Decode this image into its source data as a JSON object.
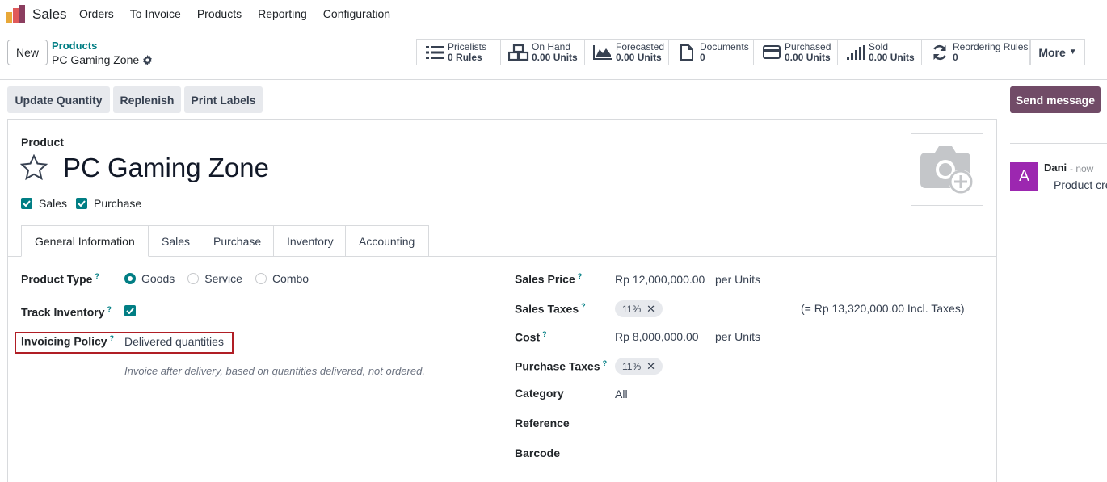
{
  "nav": {
    "app_name": "Sales",
    "menu": [
      "Orders",
      "To Invoice",
      "Products",
      "Reporting",
      "Configuration"
    ]
  },
  "control_panel": {
    "new_label": "New",
    "breadcrumb_parent": "Products",
    "breadcrumb_current": "PC Gaming Zone",
    "smart_buttons": [
      {
        "label": "Pricelists",
        "value": "0",
        "unit": "Rules",
        "icon": "list-icon"
      },
      {
        "label": "On Hand",
        "value": "0.00",
        "unit": "Units",
        "icon": "cubes-icon"
      },
      {
        "label": "Forecasted",
        "value": "0.00",
        "unit": "Units",
        "icon": "area-chart-icon"
      },
      {
        "label": "Documents",
        "value": "0",
        "unit": "",
        "icon": "document-icon"
      },
      {
        "label": "Purchased",
        "value": "0.00",
        "unit": "Units",
        "icon": "credit-card-icon"
      },
      {
        "label": "Sold",
        "value": "0.00",
        "unit": "Units",
        "icon": "signal-icon"
      },
      {
        "label": "Reordering Rules",
        "value": "0",
        "unit": "",
        "icon": "refresh-icon"
      }
    ],
    "more_label": "More"
  },
  "actions": {
    "update_quantity": "Update Quantity",
    "replenish": "Replenish",
    "print_labels": "Print Labels",
    "send_message": "Send message"
  },
  "product": {
    "section_label": "Product",
    "name": "PC Gaming Zone",
    "checks": {
      "sales": "Sales",
      "purchase": "Purchase"
    }
  },
  "tabs": [
    "General Information",
    "Sales",
    "Purchase",
    "Inventory",
    "Accounting"
  ],
  "general": {
    "product_type_label": "Product Type",
    "product_type_options": [
      "Goods",
      "Service",
      "Combo"
    ],
    "product_type_selected": "Goods",
    "track_inventory_label": "Track Inventory",
    "track_inventory": true,
    "invoicing_policy_label": "Invoicing Policy",
    "invoicing_policy_value": "Delivered quantities",
    "invoicing_hint": "Invoice after delivery, based on quantities delivered, not ordered.",
    "sales_price_label": "Sales Price",
    "sales_price": "Rp 12,000,000.00",
    "per_units_1": "per Units",
    "sales_taxes_label": "Sales Taxes",
    "sales_tax": "11%",
    "incl_taxes": "(= Rp 13,320,000.00 Incl. Taxes)",
    "cost_label": "Cost",
    "cost": "Rp 8,000,000.00",
    "per_units_2": "per Units",
    "purchase_taxes_label": "Purchase Taxes",
    "purchase_tax": "11%",
    "category_label": "Category",
    "category": "All",
    "reference_label": "Reference",
    "barcode_label": "Barcode",
    "help_mark": "?"
  },
  "chatter": {
    "avatar_letter": "A",
    "author": "Dani",
    "time": "- now",
    "message": "Product created"
  },
  "colors": {
    "brand": "#714b67",
    "accent": "#017e84",
    "highlight": "#b01e25",
    "avatar": "#9c27b0"
  }
}
